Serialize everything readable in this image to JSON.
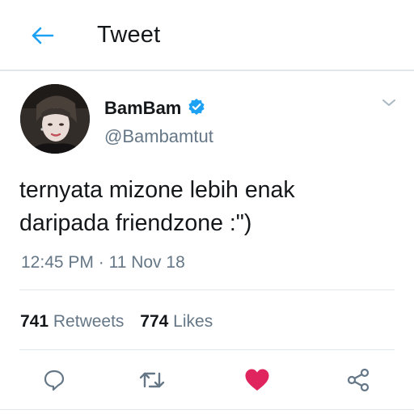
{
  "header": {
    "title": "Tweet",
    "back_icon": "arrow-left-icon",
    "accent_color": "#1da1f2"
  },
  "author": {
    "name": "BamBam",
    "handle": "@Bambamtut",
    "verified": true,
    "verified_color": "#1da1f2"
  },
  "tweet": {
    "text_lines": [
      "ternyata mizone lebih enak",
      "daripada friendzone :\")"
    ],
    "time": "12:45 PM",
    "separator": "·",
    "date": "11 Nov 18"
  },
  "stats": {
    "retweets_count": "741",
    "retweets_label": "Retweets",
    "likes_count": "774",
    "likes_label": "Likes"
  },
  "actions": {
    "reply_icon": "reply-icon",
    "retweet_icon": "retweet-icon",
    "like_icon": "heart-icon",
    "like_color": "#e0245e",
    "share_icon": "share-icon",
    "liked": true
  }
}
